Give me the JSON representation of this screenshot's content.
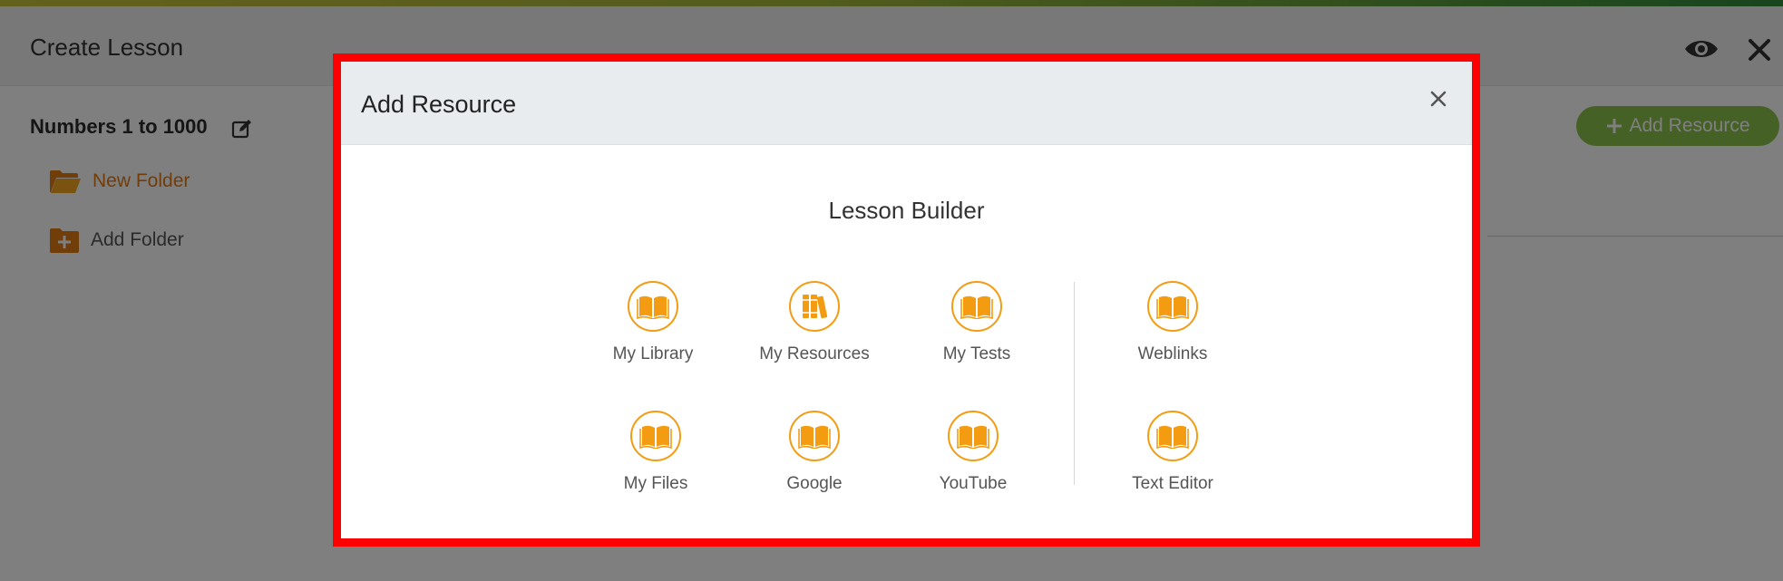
{
  "app": {
    "title": "Create Lesson",
    "lesson_name": "Numbers 1 to 1000",
    "folders": [
      {
        "label": "New Folder"
      },
      {
        "label": "Add Folder"
      }
    ],
    "add_resource_button": "Add Resource",
    "header_icons": [
      "eye-icon",
      "close-icon"
    ]
  },
  "modal": {
    "title": "Add Resource",
    "close_icon": "close-icon",
    "section_heading": "Lesson Builder",
    "tiles": [
      {
        "label": "My Library",
        "icon": "book-icon"
      },
      {
        "label": "My Resources",
        "icon": "books-icon"
      },
      {
        "label": "My Tests",
        "icon": "book-icon"
      },
      {
        "label": "Weblinks",
        "icon": "book-icon"
      },
      {
        "label": "My Files",
        "icon": "book-icon"
      },
      {
        "label": "Google",
        "icon": "book-icon"
      },
      {
        "label": "YouTube",
        "icon": "book-icon"
      },
      {
        "label": "Text Editor",
        "icon": "book-icon"
      }
    ]
  },
  "colors": {
    "accent_orange": "#f39c12",
    "button_green": "#8bc34a",
    "highlight_border": "#ff0000",
    "folder_orange": "#e27b12"
  }
}
